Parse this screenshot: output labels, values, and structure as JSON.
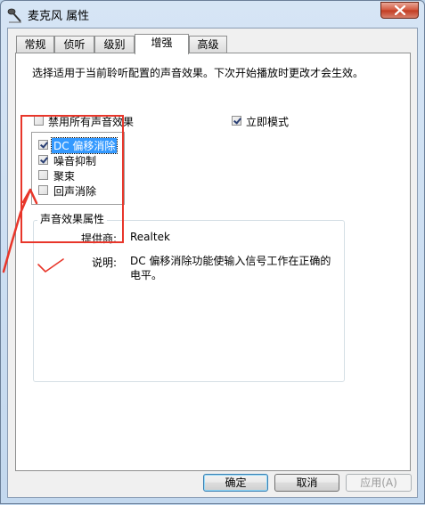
{
  "window": {
    "title": "麦克风 属性",
    "icon": "microphone-icon",
    "close_icon": "close-icon"
  },
  "tabs": [
    {
      "label": "常规",
      "active": false
    },
    {
      "label": "侦听",
      "active": false
    },
    {
      "label": "级别",
      "active": false
    },
    {
      "label": "增强",
      "active": true
    },
    {
      "label": "高级",
      "active": false
    }
  ],
  "enhance": {
    "description": "选择适用于当前聆听配置的声音效果。下次开始播放时更改才会生效。",
    "disable_all": {
      "label": "禁用所有声音效果",
      "checked": false
    },
    "immediate_mode": {
      "label": "立即模式",
      "checked": true
    },
    "effects": [
      {
        "label": "DC 偏移消除",
        "checked": true,
        "selected": true
      },
      {
        "label": "噪音抑制",
        "checked": true,
        "selected": false
      },
      {
        "label": "聚束",
        "checked": false,
        "selected": false
      },
      {
        "label": "回声消除",
        "checked": false,
        "selected": false
      }
    ],
    "properties": {
      "group_title": "声音效果属性",
      "provider_label": "提供商:",
      "provider_value": "Realtek",
      "desc_label": "说明:",
      "desc_value": "DC 偏移消除功能使输入信号工作在正确的电平。"
    }
  },
  "buttons": {
    "ok": "确定",
    "cancel": "取消",
    "apply": "应用(A)"
  },
  "colors": {
    "selection": "#3399ff",
    "annotation": "#e8362a"
  }
}
